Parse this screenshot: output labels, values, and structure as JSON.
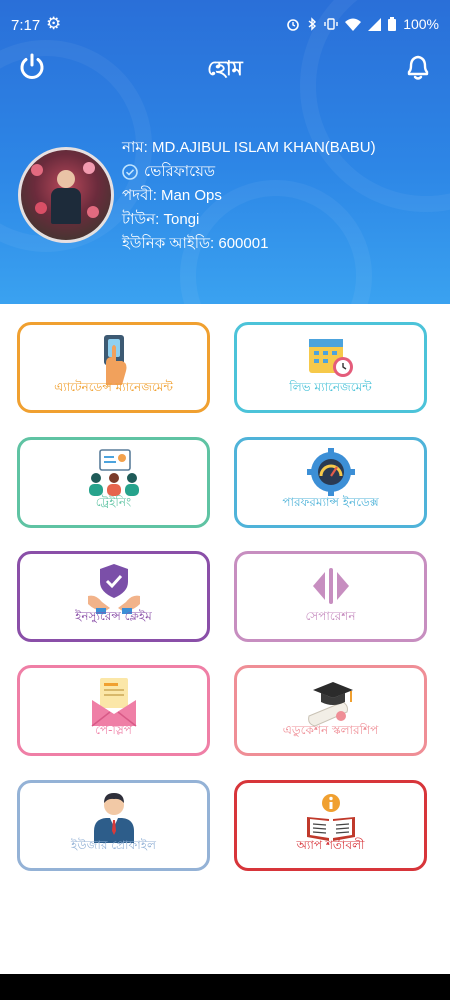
{
  "status_bar": {
    "time": "7:17",
    "battery": "100%"
  },
  "app_bar": {
    "title": "হোম"
  },
  "profile": {
    "name_line": "নাম: MD.AJIBUL ISLAM KHAN(BABU)",
    "verified": "ভেরিফায়েড",
    "designation_line": "পদবী: Man Ops",
    "town_line": "টাউন: Tongi",
    "unique_id_line": "ইউনিক আইডি: 600001"
  },
  "menu": [
    {
      "label": "এ্যাটেনডেন্স ম্যানেজমেন্ট",
      "color": "#f0a030",
      "icon": "fingerprint-scanner-icon"
    },
    {
      "label": "লিভ ম্যানেজমেন্ট",
      "color": "#4cc3d9",
      "icon": "calendar-clock-icon"
    },
    {
      "label": "ট্রেইনিং",
      "color": "#5fc3a3",
      "icon": "training-presentation-icon"
    },
    {
      "label": "পারফরম্যান্স ইনডেক্স",
      "color": "#4fb3d9",
      "icon": "performance-gauge-icon"
    },
    {
      "label": "ইনস্যুরেন্স ক্লেইম",
      "color": "#8a4fa8",
      "icon": "insurance-shield-icon"
    },
    {
      "label": "সেপারেশন",
      "color": "#c78ec0",
      "icon": "separation-arrows-icon"
    },
    {
      "label": "পে-স্লিপ",
      "color": "#ef7fa6",
      "icon": "payslip-envelope-icon"
    },
    {
      "label": "এডুকেশন স্কলারশিপ",
      "color": "#ef8e96",
      "icon": "graduation-cap-icon"
    },
    {
      "label": "ইউজার প্রোফাইল",
      "color": "#94b2d6",
      "icon": "user-profile-icon"
    },
    {
      "label": "অ্যাপ শর্তাবলী",
      "color": "#d7353a",
      "icon": "info-book-icon"
    }
  ]
}
